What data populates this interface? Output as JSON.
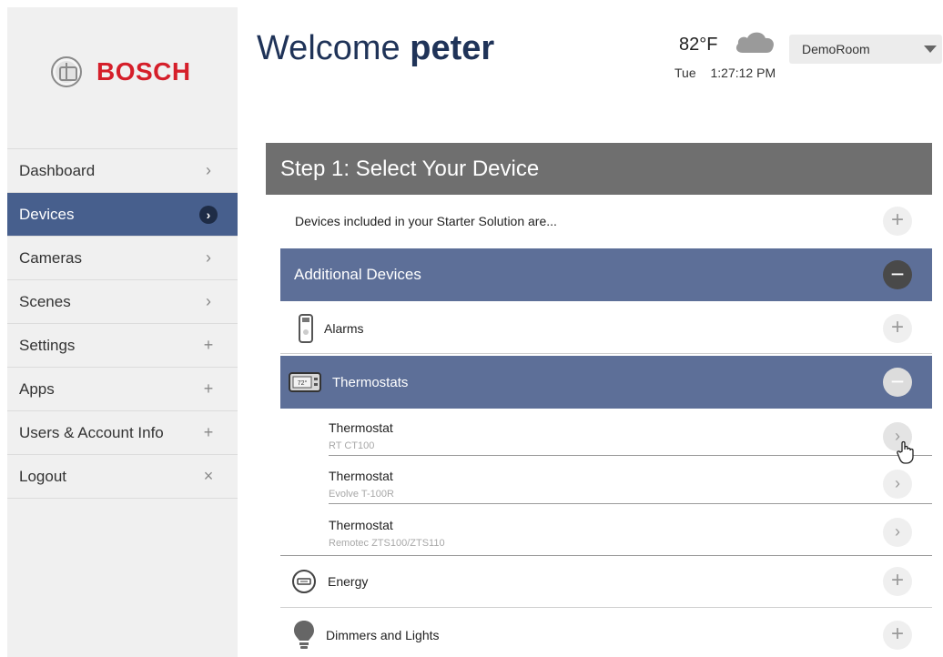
{
  "brand": {
    "name": "BOSCH"
  },
  "sidebar": {
    "items": [
      {
        "label": "Dashboard",
        "icon": "chevron-right-icon",
        "glyph": "›",
        "active": false
      },
      {
        "label": "Devices",
        "icon": "chevron-right-circle-icon",
        "glyph": "›",
        "active": true
      },
      {
        "label": "Cameras",
        "icon": "chevron-right-icon",
        "glyph": "›",
        "active": false
      },
      {
        "label": "Scenes",
        "icon": "chevron-right-icon",
        "glyph": "›",
        "active": false
      },
      {
        "label": "Settings",
        "icon": "plus-icon",
        "glyph": "+",
        "active": false
      },
      {
        "label": "Apps",
        "icon": "plus-icon",
        "glyph": "+",
        "active": false
      },
      {
        "label": "Users & Account Info",
        "icon": "plus-icon",
        "glyph": "+",
        "active": false
      },
      {
        "label": "Logout",
        "icon": "close-icon",
        "glyph": "×",
        "active": false
      }
    ]
  },
  "header": {
    "welcome_prefix": "Welcome",
    "username": "peter",
    "temperature": "82°F",
    "weather_icon": "cloud-icon",
    "day": "Tue",
    "time": "1:27:12 PM",
    "room": "DemoRoom"
  },
  "main": {
    "step_title": "Step 1: Select Your Device",
    "starter_text": "Devices included in your Starter Solution are...",
    "additional_title": "Additional Devices",
    "alarms_label": "Alarms",
    "thermostats_label": "Thermostats",
    "thermostat_icon_text": "72°",
    "thermostats": [
      {
        "name": "Thermostat",
        "model": "RT CT100"
      },
      {
        "name": "Thermostat",
        "model": "Evolve T-100R"
      },
      {
        "name": "Thermostat",
        "model": "Remotec ZTS100/ZTS110"
      }
    ],
    "energy_label": "Energy",
    "dimmers_label": "Dimmers and Lights",
    "plus_glyph": "+",
    "minus_glyph": "−",
    "chevron_glyph": "›"
  },
  "colors": {
    "brand_red": "#d51f2a",
    "nav_active": "#475f8d",
    "section_header": "#5d6f98",
    "step_header": "#6f6f6f",
    "title_blue": "#1f3358"
  }
}
